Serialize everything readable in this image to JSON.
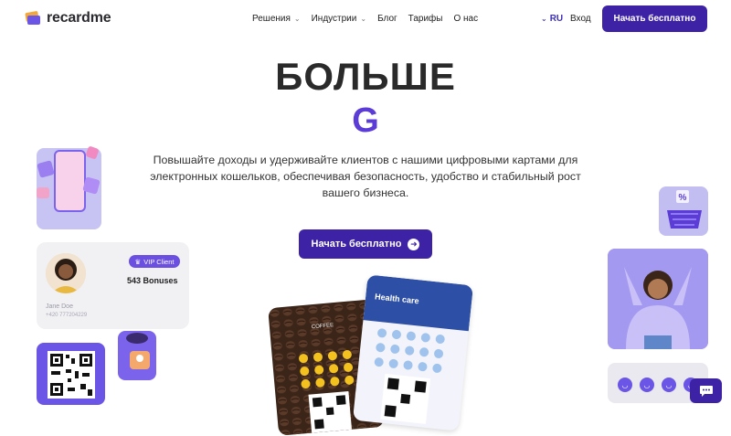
{
  "header": {
    "logo_text": "recardme",
    "nav": [
      {
        "label": "Решения",
        "has_dropdown": true
      },
      {
        "label": "Индустрии",
        "has_dropdown": true
      },
      {
        "label": "Блог",
        "has_dropdown": false
      },
      {
        "label": "Тарифы",
        "has_dropdown": false
      },
      {
        "label": "О нас",
        "has_dropdown": false
      }
    ],
    "lang": "RU",
    "login": "Вход",
    "cta": "Начать бесплатно"
  },
  "hero": {
    "title": "БОЛЬШЕ",
    "letter": "G",
    "description": "Повышайте доходы и удерживайте клиентов с нашими цифровыми картами для электронных кошельков, обеспечивая безопасность, удобство и стабильный рост вашего бизнеса.",
    "cta": "Начать бесплатно"
  },
  "profile_card": {
    "badge": "VIP Client",
    "bonuses": "543 Bonuses",
    "name": "Jane Doe",
    "phone": "+420 777204229"
  },
  "cards": {
    "coffee_label": "COFFEE",
    "health_label": "Health care"
  },
  "colors": {
    "brand": "#3d22a6",
    "accent": "#6a55e6",
    "lavender": "#c7c4f3"
  }
}
